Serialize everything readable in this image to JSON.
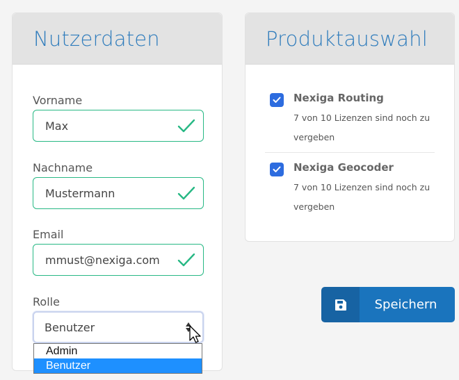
{
  "user_card": {
    "title": "Nutzerdaten",
    "fields": [
      {
        "label": "Vorname",
        "value": "Max"
      },
      {
        "label": "Nachname",
        "value": "Mustermann"
      },
      {
        "label": "Email",
        "value": "mmust@nexiga.com"
      }
    ],
    "role": {
      "label": "Rolle",
      "selected": "Benutzer",
      "options": [
        "Admin",
        "Benutzer"
      ]
    }
  },
  "product_card": {
    "title": "Produktauswahl",
    "products": [
      {
        "name": "Nexiga Routing",
        "description": "7 von 10 Lizenzen sind noch zu vergeben",
        "checked": true
      },
      {
        "name": "Nexiga Geocoder",
        "description": "7 von 10 Lizenzen sind noch zu vergeben",
        "checked": true
      }
    ]
  },
  "save_button": {
    "label": "Speichern"
  },
  "colors": {
    "title_blue": "#2f7cbc",
    "valid_green": "#27b884",
    "checkbox_blue": "#2d6cdf",
    "button_blue": "#1a74bd",
    "button_icon_blue": "#1763a3",
    "option_highlight": "#1e90ff"
  },
  "icons": {
    "valid": "checkmark-icon",
    "select": "select-arrows-icon",
    "save": "floppy-disk-icon",
    "cursor": "mouse-pointer-icon"
  }
}
